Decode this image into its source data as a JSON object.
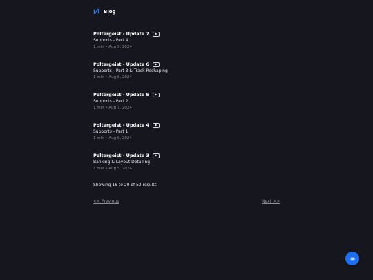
{
  "header": {
    "brand": "Blog",
    "logo_icon": "slashed-bracket-logo-icon",
    "accent": "#2f7cf6"
  },
  "posts": [
    {
      "title": "Poltergeist - Update 7",
      "subtitle": "Supports - Part 4",
      "meta": "1 min • Aug 9, 2024",
      "icon": "video-play-icon"
    },
    {
      "title": "Poltergeist - Update 6",
      "subtitle": "Supports - Part 3 & Track Reshaping",
      "meta": "1 min • Aug 8, 2024",
      "icon": "video-play-icon"
    },
    {
      "title": "Poltergeist - Update 5",
      "subtitle": "Supports - Part 2",
      "meta": "1 min • Aug 7, 2024",
      "icon": "video-play-icon"
    },
    {
      "title": "Poltergeist - Update 4",
      "subtitle": "Supports - Part 1",
      "meta": "1 min • Aug 6, 2024",
      "icon": "video-play-icon"
    },
    {
      "title": "Poltergeist - Update 3",
      "subtitle": "Banking & Layout Detailing",
      "meta": "1 min • Aug 5, 2024",
      "icon": "video-play-icon"
    }
  ],
  "results_text": "Showing 16 to 20 of 52 results",
  "pagination": {
    "previous_label": "<< Previous",
    "next_label": "Next >>"
  },
  "fab": {
    "icon": "equals-menu-icon",
    "color": "#1d6df0"
  }
}
